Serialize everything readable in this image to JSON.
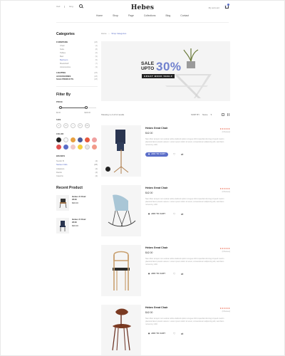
{
  "topbar": {
    "left_items": [
      "Usd",
      "Eng"
    ],
    "logo": "Hebes",
    "account_label": "My account"
  },
  "nav": [
    "Home",
    "Shop",
    "Page",
    "Collections",
    "Blog",
    "Contact"
  ],
  "breadcrumb": {
    "home": "Home",
    "current": "Shop Categories"
  },
  "sidebar": {
    "categories_title": "Categories",
    "furniture": {
      "label": "FURNITURE",
      "count": "(28)"
    },
    "furniture_items": [
      {
        "label": "Chair",
        "count": "(4)"
      },
      {
        "label": "Sofa",
        "count": "(8)"
      },
      {
        "label": "Tables",
        "count": "(6)"
      },
      {
        "label": "Bed",
        "count": "(9)"
      },
      {
        "label": "Bedroom",
        "count": "(5)"
      },
      {
        "label": "Bookshelf",
        "count": "(7)"
      },
      {
        "label": "Accessories",
        "count": "(3)"
      }
    ],
    "other_categories": [
      {
        "label": "LIGHTING",
        "count": "(28)"
      },
      {
        "label": "ACCESSORIES",
        "count": "(28)"
      },
      {
        "label": "SALE PRODUCTS",
        "count": "(28)"
      }
    ],
    "filter_title": "Filter By",
    "price_label": "PRICE",
    "price_min": "$0.00",
    "price_max": "$200.00",
    "size_label": "SIZE",
    "sizes": [
      "S",
      "M",
      "L",
      "XL",
      "XXL"
    ],
    "color_label": "COLOR",
    "colors": [
      "#222222",
      "#f8f8f8",
      "#e8a040",
      "#4a5a9a",
      "#e8593e",
      "#f0a0a0",
      "#e05050",
      "#5a6dc8",
      "#f0c8c8",
      "#f5d040",
      "#e8e8e8",
      "#f29a8a"
    ],
    "brand_label": "BRANDS",
    "brands": [
      {
        "label": "Nordic B",
        "count": "(4)"
      },
      {
        "label": "Nielsen Kids",
        "count": "(28)"
      },
      {
        "label": "Adaptaro",
        "count": "(4)"
      },
      {
        "label": "Danilo",
        "count": "(4)"
      },
      {
        "label": "Caiwinx",
        "count": "(4)"
      }
    ],
    "recent_title": "Recent Product",
    "recent": [
      {
        "name": "Hebes X Chair 2018",
        "price": "$30.00"
      },
      {
        "name": "Hebes X Chair 2018",
        "price": "$30.00"
      }
    ]
  },
  "banner": {
    "line1": "SALE",
    "line2": "UPTO",
    "big": "30%",
    "shelf": "GREAT BOOK SHELF"
  },
  "toolbar": {
    "count": "Showing 1–4 of 12 results",
    "sort_label": "SORT BY",
    "sort_value": "Name"
  },
  "products": [
    {
      "name": "Hebes Great Chair",
      "price": "$42.00",
      "stars": "★★★★★",
      "review": "(0 Review)",
      "add": "ADD TO CART"
    },
    {
      "name": "Hebes Great Chair",
      "price": "$42.00",
      "stars": "★★★★★",
      "review": "(0 Review)",
      "add": "ADD TO CART"
    },
    {
      "name": "Hebes Great Chair",
      "price": "$42.00",
      "stars": "★★★★★",
      "review": "(0 Review)",
      "add": "ADD TO CART"
    },
    {
      "name": "Hebes Great Chair",
      "price": "$42.00",
      "stars": "★★★★★",
      "review": "(0 Review)",
      "add": "ADD TO CART"
    }
  ],
  "product_desc": "Nam liber tempor cum soluta nobis eleifend option congue nihil imperdiet doming id quod mazim placerat facer possim assum. Lorem ipsum dolor sit amet, consectetuer adipiscing elit, sed diam nonummy nibh."
}
